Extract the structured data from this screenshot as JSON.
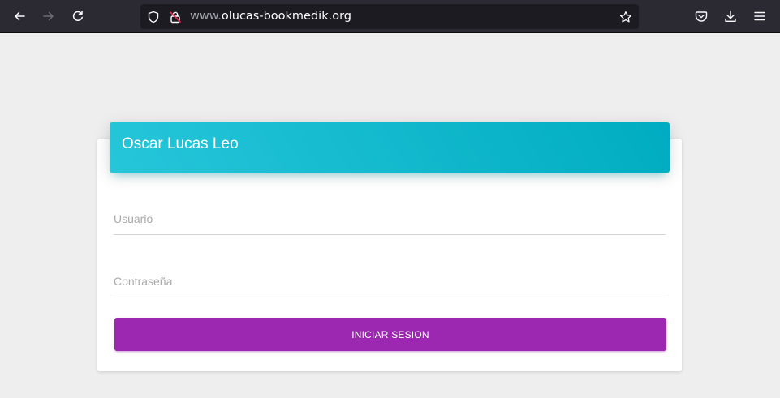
{
  "browser": {
    "url_prefix": "www.",
    "url_domain": "olucas-bookmedik.org",
    "icons": {
      "back": "arrow-left-icon",
      "forward": "arrow-right-icon",
      "reload": "reload-icon",
      "tracking": "shield-icon",
      "insecure": "insecure-lock-icon",
      "bookmark": "star-icon",
      "pocket": "pocket-icon",
      "downloads": "download-icon",
      "menu": "hamburger-menu-icon"
    }
  },
  "login": {
    "title": "Oscar Lucas Leo",
    "username_placeholder": "Usuario",
    "password_placeholder": "Contraseña",
    "submit_label": "INICIAR SESION"
  },
  "colors": {
    "header_gradient_start": "#26c6da",
    "header_gradient_end": "#00acc1",
    "button": "#9c27b0",
    "page_bg": "#eeeeee",
    "toolbar_bg": "#2b2a33"
  }
}
